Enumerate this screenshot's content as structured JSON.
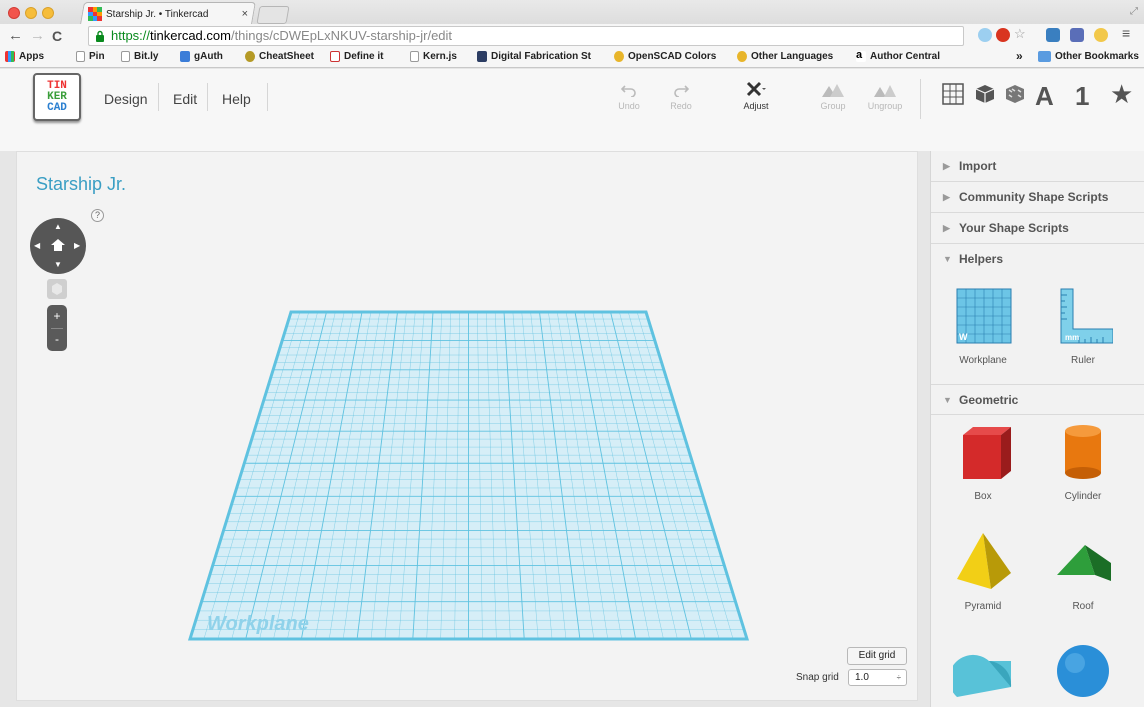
{
  "browser": {
    "tab_title": "Starship Jr. • Tinkercad",
    "tab_close": "×",
    "url_scheme": "https://",
    "url_host": "tinkercad.com",
    "url_path": "/things/cDWEpLxNKUV-starship-jr/edit",
    "bookmarks": [
      {
        "label": "Apps"
      },
      {
        "label": "Pin"
      },
      {
        "label": "Bit.ly"
      },
      {
        "label": "gAuth"
      },
      {
        "label": "CheatSheet"
      },
      {
        "label": "Define it"
      },
      {
        "label": "Kern.js"
      },
      {
        "label": "Digital Fabrication St"
      },
      {
        "label": "OpenSCAD Colors"
      },
      {
        "label": "Other Languages"
      },
      {
        "label": "Author Central"
      }
    ],
    "bookmarks_overflow": "»",
    "other_bookmarks": "Other Bookmarks"
  },
  "logo": {
    "line1": "TIN",
    "line2": "KER",
    "line3": "CAD"
  },
  "menu": {
    "design": "Design",
    "edit": "Edit",
    "help": "Help"
  },
  "toolbar": {
    "undo": "Undo",
    "redo": "Redo",
    "adjust": "Adjust",
    "group": "Group",
    "ungroup": "Ungroup"
  },
  "view_tools": {
    "text": "A",
    "number": "1",
    "star": "★"
  },
  "canvas": {
    "title": "Starship Jr.",
    "help": "?",
    "zoom_in": "+",
    "zoom_out": "-",
    "workplane_label": "Workplane",
    "edit_grid": "Edit grid",
    "snap_grid_label": "Snap grid",
    "snap_grid_value": "1.0",
    "snap_grid_arrows": "÷"
  },
  "panel": {
    "sections": {
      "import": "Import",
      "community": "Community Shape Scripts",
      "your_scripts": "Your Shape Scripts",
      "helpers": "Helpers",
      "geometric": "Geometric"
    },
    "helpers": [
      {
        "label": "Workplane"
      },
      {
        "label": "Ruler"
      }
    ],
    "geometric": [
      {
        "label": "Box"
      },
      {
        "label": "Cylinder"
      },
      {
        "label": "Pyramid"
      },
      {
        "label": "Roof"
      }
    ],
    "ruler_unit": "mm",
    "workplane_mark": "W"
  },
  "colors": {
    "accent": "#3a9ec4",
    "grid": "#5fc2e0",
    "box": "#d42a2a",
    "cylinder": "#e8780f",
    "pyramid": "#f2cf16",
    "roof": "#2e9e3b",
    "half_cylinder": "#58c2d8",
    "sphere": "#2a8fd8"
  }
}
